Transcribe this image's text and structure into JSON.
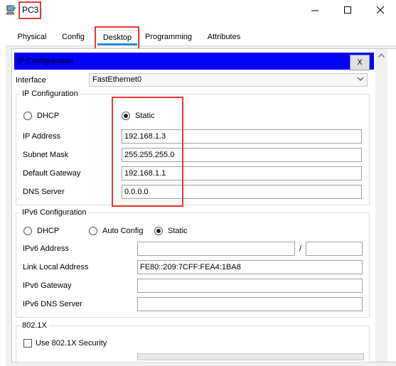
{
  "window": {
    "title": "PC3",
    "icon": "packet-tracer-pc-icon",
    "controls": [
      "minimize-icon",
      "maximize-icon",
      "close-icon"
    ]
  },
  "tabs": [
    {
      "label": "Physical",
      "active": false
    },
    {
      "label": "Config",
      "active": false
    },
    {
      "label": "Desktop",
      "active": true
    },
    {
      "label": "Programming",
      "active": false
    },
    {
      "label": "Attributes",
      "active": false
    }
  ],
  "panel": {
    "title": "IP Configuration",
    "close_label": "X"
  },
  "interface": {
    "label": "Interface",
    "value": "FastEthernet0"
  },
  "ipv4": {
    "group_label": "IP Configuration",
    "dhcp_label": "DHCP",
    "static_label": "Static",
    "selected": "Static",
    "fields": [
      {
        "label": "IP Address",
        "value": "192.168.1.3"
      },
      {
        "label": "Subnet Mask",
        "value": "255.255.255.0"
      },
      {
        "label": "Default Gateway",
        "value": "192.168.1.1"
      },
      {
        "label": "DNS Server",
        "value": "0.0.0.0"
      }
    ]
  },
  "ipv6": {
    "group_label": "IPv6 Configuration",
    "dhcp_label": "DHCP",
    "auto_label": "Auto Config",
    "static_label": "Static",
    "selected": "Static",
    "address_label": "IPv6 Address",
    "address_value": "",
    "prefix_separator": "/",
    "prefix_value": "",
    "link_local_label": "Link Local Address",
    "link_local_value": "FE80::209:7CFF:FEA4:1BA8",
    "gateway_label": "IPv6 Gateway",
    "gateway_value": "",
    "dns_label": "IPv6 DNS Server",
    "dns_value": ""
  },
  "dot1x": {
    "group_label": "802.1X",
    "use_label": "Use 802.1X Security",
    "checked": false
  },
  "colors": {
    "header_bar": "#0000ff",
    "tab_accent": "#1e8ad6",
    "highlight_box": "#e53935"
  }
}
